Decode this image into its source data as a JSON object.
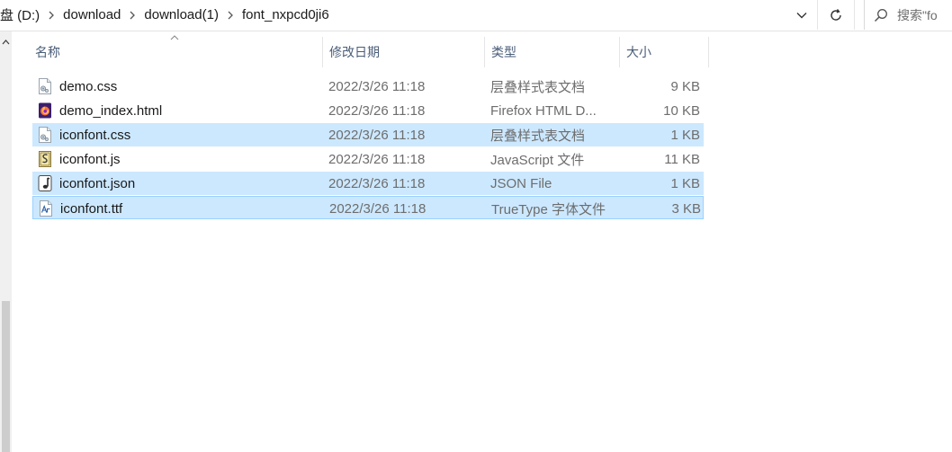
{
  "breadcrumb": [
    "盘 (D:)",
    "download",
    "download(1)",
    "font_nxpcd0ji6"
  ],
  "search": {
    "placeholder": "搜索\"fo"
  },
  "columns": {
    "name": "名称",
    "date": "修改日期",
    "type": "类型",
    "size": "大小"
  },
  "files": [
    {
      "name": "demo.css",
      "date": "2022/3/26 11:18",
      "type": "层叠样式表文档",
      "size": "9 KB",
      "icon": "css-file-icon",
      "selected": false
    },
    {
      "name": "demo_index.html",
      "date": "2022/3/26 11:18",
      "type": "Firefox HTML D...",
      "size": "10 KB",
      "icon": "firefox-html-icon",
      "selected": false
    },
    {
      "name": "iconfont.css",
      "date": "2022/3/26 11:18",
      "type": "层叠样式表文档",
      "size": "1 KB",
      "icon": "css-file-icon",
      "selected": true
    },
    {
      "name": "iconfont.js",
      "date": "2022/3/26 11:18",
      "type": "JavaScript 文件",
      "size": "11 KB",
      "icon": "js-file-icon",
      "selected": false
    },
    {
      "name": "iconfont.json",
      "date": "2022/3/26 11:18",
      "type": "JSON File",
      "size": "1 KB",
      "icon": "json-file-icon",
      "selected": true
    },
    {
      "name": "iconfont.ttf",
      "date": "2022/3/26 11:18",
      "type": "TrueType 字体文件",
      "size": "3 KB",
      "icon": "ttf-file-icon",
      "selected": true,
      "focused": true
    }
  ],
  "colors": {
    "selection": "#cce8ff",
    "focus_border": "#99d1ff",
    "header_text": "#4a5d78"
  }
}
